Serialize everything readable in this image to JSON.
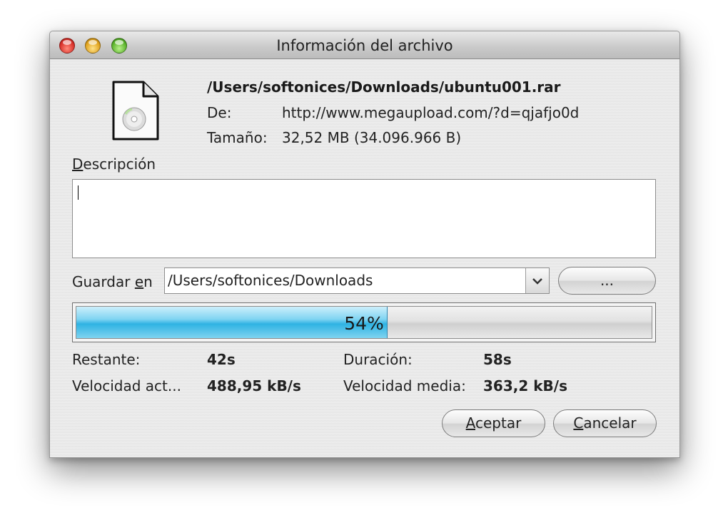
{
  "window": {
    "title": "Información del archivo"
  },
  "file": {
    "path": "/Users/softonices/Downloads/ubuntu001.rar",
    "from_label": "De:",
    "from_value": "http://www.megaupload.com/?d=qjafjo0d",
    "size_label": "Tamaño:",
    "size_value": "32,52 MB (34.096.966 B)",
    "icon": "disc-file-icon"
  },
  "description": {
    "label_underlined": "D",
    "label_rest": "escripción",
    "value": ""
  },
  "save": {
    "label_start": "Guardar ",
    "label_underlined": "e",
    "label_end": "n",
    "path": "/Users/softonices/Downloads",
    "browse_label": "..."
  },
  "progress": {
    "percent": 54,
    "text": "54%"
  },
  "stats": {
    "remaining_label": "Restante:",
    "remaining_value": "42s",
    "duration_label": "Duración:",
    "duration_value": "58s",
    "current_speed_label": "Velocidad act...",
    "current_speed_value": "488,95 kB/s",
    "avg_speed_label": "Velocidad media:",
    "avg_speed_value": "363,2 kB/s"
  },
  "buttons": {
    "accept_underlined": "A",
    "accept_rest": "ceptar",
    "cancel_underlined": "C",
    "cancel_rest": "ancelar"
  },
  "colors": {
    "progress_fill": "#2fb3e3",
    "close": "#d8302a",
    "minimize": "#e0a21d",
    "zoom": "#5bb32b"
  }
}
